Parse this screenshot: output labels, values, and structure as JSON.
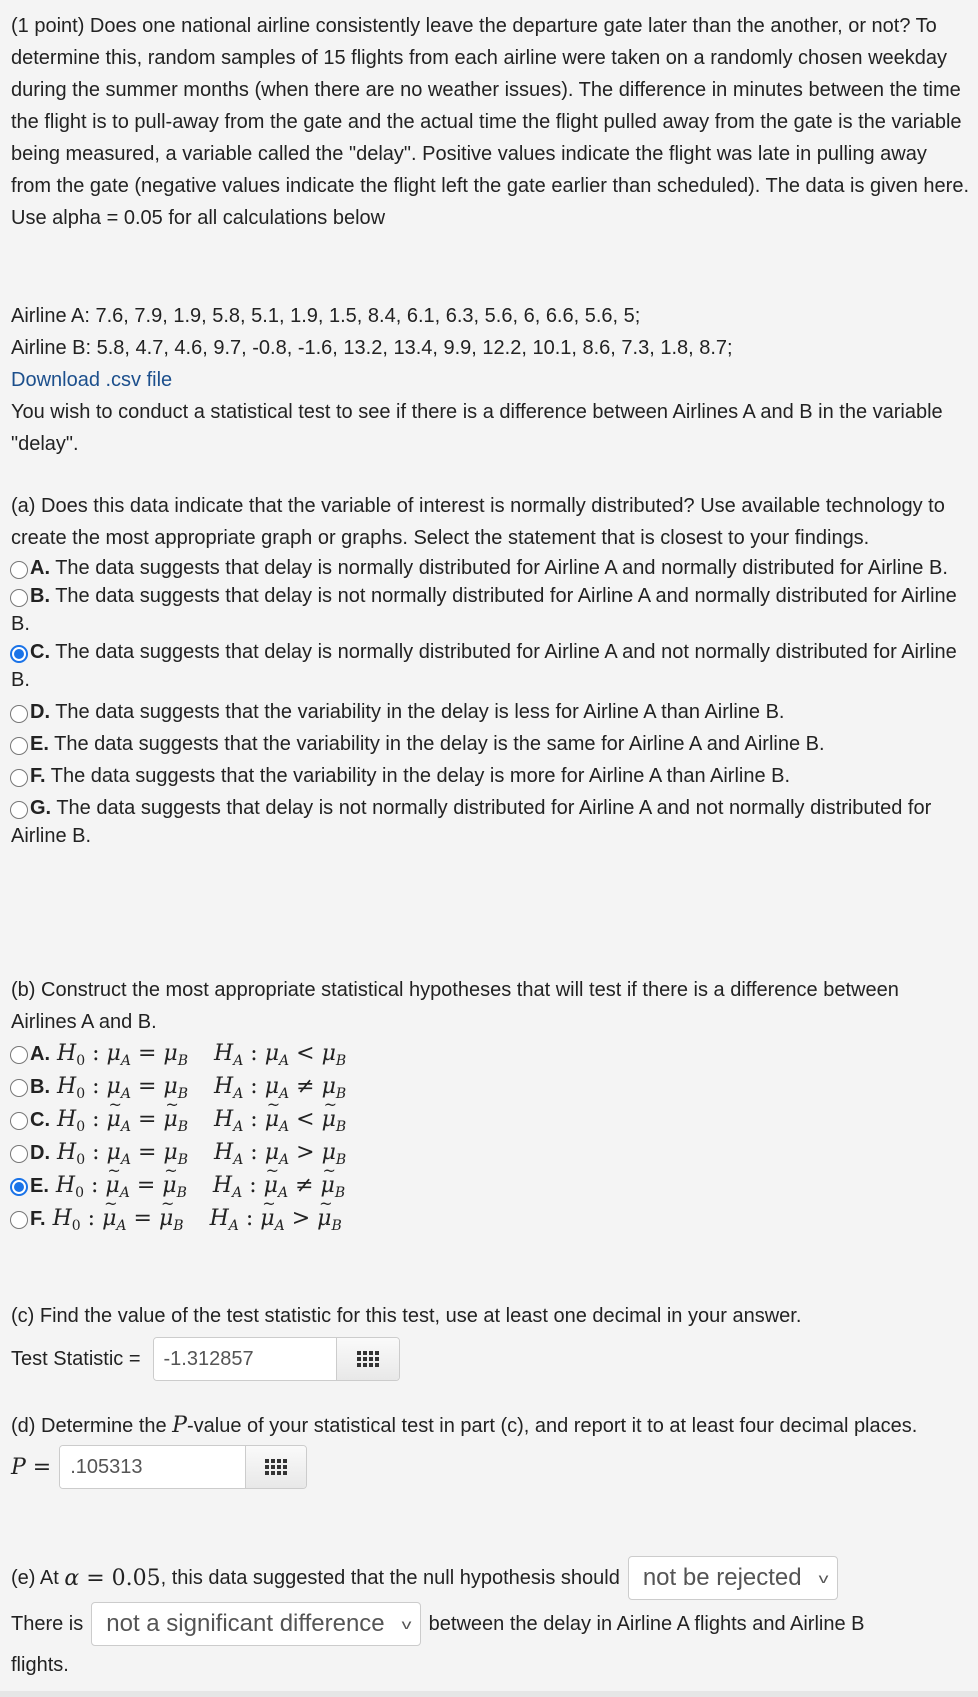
{
  "intro": {
    "text": "(1 point) Does one national airline consistently leave the departure gate later than the another, or not? To determine this, random samples of 15 flights from each airline were taken on a randomly chosen weekday during the summer months (when there are no weather issues). The difference in minutes between the time the flight is to pull-away from the gate and the actual time the flight pulled away from the gate is the variable being measured, a variable called the \"delay\". Positive values indicate the flight was late in pulling away from the gate (negative values indicate the flight left the gate earlier than scheduled). The data is given here. Use alpha = 0.05 for all calculations below"
  },
  "data_section": {
    "airline_a_label": "Airline A:",
    "airline_a_values": "7.6, 7.9, 1.9, 5.8, 5.1, 1.9, 1.5, 8.4, 6.1, 6.3, 5.6, 6, 6.6, 5.6, 5;",
    "airline_b_label": "Airline B:",
    "airline_b_values": "5.8, 4.7, 4.6, 9.7, -0.8, -1.6, 13.2, 13.4, 9.9, 12.2, 10.1, 8.6, 7.3, 1.8, 8.7;",
    "download_link": "Download .csv file",
    "follow_text": "You wish to conduct a statistical test to see if there is a difference between Airlines A and B in the variable \"delay\"."
  },
  "part_a": {
    "question": "(a) Does this data indicate that the variable of interest is normally distributed? Use available technology to create the most appropriate graph or graphs. Select the statement that is closest to your findings.",
    "selected": "C",
    "options": [
      {
        "letter": "A.",
        "text": " The data suggests that delay is normally distributed for Airline A and normally distributed for Airline B."
      },
      {
        "letter": "B.",
        "text": " The data suggests that delay is not normally distributed for Airline A and normally distributed for Airline B."
      },
      {
        "letter": "C.",
        "text": " The data suggests that delay is normally distributed for Airline A and not normally distributed for Airline B."
      },
      {
        "letter": "D.",
        "text": " The data suggests that the variability in the delay is less for Airline A than Airline B."
      },
      {
        "letter": "E.",
        "text": " The data suggests that the variability in the delay is the same for Airline A and Airline B."
      },
      {
        "letter": "F.",
        "text": " The data suggests that the variability in the delay is more for Airline A than Airline B."
      },
      {
        "letter": "G.",
        "text": " The data suggests that delay is not normally distributed for Airline A and not normally distributed for Airline B."
      }
    ]
  },
  "part_b": {
    "question": "(b) Construct the most appropriate statistical hypotheses that will test if there is a difference between Airlines A and B.",
    "selected": "E",
    "options": [
      {
        "letter": "A.",
        "param": "mean",
        "h0": "=",
        "ha": "<"
      },
      {
        "letter": "B.",
        "param": "mean",
        "h0": "=",
        "ha": "≠"
      },
      {
        "letter": "C.",
        "param": "median",
        "h0": "=",
        "ha": "<"
      },
      {
        "letter": "D.",
        "param": "mean",
        "h0": "=",
        "ha": ">"
      },
      {
        "letter": "E.",
        "param": "median",
        "h0": "=",
        "ha": "≠"
      },
      {
        "letter": "F.",
        "param": "median",
        "h0": "=",
        "ha": ">"
      }
    ]
  },
  "part_c": {
    "question": "(c) Find the value of the test statistic for this test, use at least one decimal in your answer.",
    "label": "Test Statistic =",
    "value": "-1.312857"
  },
  "part_d": {
    "question_before": "(d) Determine the ",
    "question_symbol": "P",
    "question_after": "-value of your statistical test in part (c), and report it to at least four decimal places.",
    "label_symbol": "P",
    "label_eq": " =",
    "value": ".105313"
  },
  "part_e": {
    "line1_before": "(e) At ",
    "alpha_symbol": "α",
    "alpha_eq": " = ",
    "alpha_value": "0.05",
    "line1_after": ", this data suggested that the null hypothesis should",
    "select1_value": "not be rejected",
    "line2_before": "There is",
    "select2_value": "not a significant difference",
    "line2_after": "between the delay in Airline A flights and Airline B",
    "line3": "flights."
  },
  "icons": {
    "keypad": "keypad-icon",
    "chevron": "chevron-down-icon"
  }
}
